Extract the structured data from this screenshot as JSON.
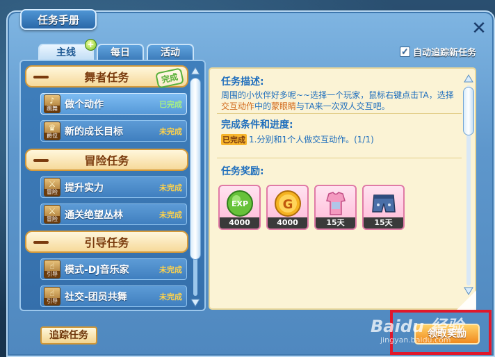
{
  "window": {
    "title": "任务手册",
    "close_icon": "close-icon"
  },
  "tabs": [
    {
      "label": "主线",
      "active": true,
      "badge": "+"
    },
    {
      "label": "每日",
      "active": false
    },
    {
      "label": "活动",
      "active": false
    }
  ],
  "auto_track": {
    "label": "自动追踪新任务",
    "checked": true,
    "check_mark": "✓"
  },
  "categories": [
    {
      "label": "舞者任务",
      "stamp": "完成",
      "tasks": [
        {
          "name": "做个动作",
          "status": "已完成",
          "icon_label": "跳舞",
          "icon_glyph": "♪",
          "done": true,
          "selected": true
        },
        {
          "name": "新的成长目标",
          "status": "未完成",
          "icon_label": "爵位",
          "icon_glyph": "♛",
          "done": false
        }
      ]
    },
    {
      "label": "冒险任务",
      "tasks": [
        {
          "name": "提升实力",
          "status": "未完成",
          "icon_label": "冒险",
          "icon_glyph": "⚔",
          "done": false
        },
        {
          "name": "通关绝望丛林",
          "status": "未完成",
          "icon_label": "冒险",
          "icon_glyph": "⚔",
          "done": false
        }
      ]
    },
    {
      "label": "引导任务",
      "tasks": [
        {
          "name": "模式-DJ音乐家",
          "status": "未完成",
          "icon_label": "引导",
          "icon_glyph": "☝",
          "done": false
        },
        {
          "name": "社交-团员共舞",
          "status": "未完成",
          "icon_label": "引导",
          "icon_glyph": "☝",
          "done": false
        }
      ]
    }
  ],
  "detail": {
    "desc_title": "任务描述:",
    "desc_parts": [
      "周围的小伙伴好多呢~~选择一个玩家，鼠标右键点击TA，选择",
      "交互动作",
      "中的",
      "蒙眼睛",
      "与TA来一次双人交互吧。"
    ],
    "progress_title": "完成条件和进度:",
    "progress_tag": "已完成",
    "progress_text": "1.分别和1个人做交互动作。(1/1)",
    "reward_title": "任务奖励:",
    "rewards": [
      {
        "type": "exp",
        "icon_text": "EXP",
        "amount": "4000"
      },
      {
        "type": "gold",
        "icon_text": "G",
        "amount": "4000"
      },
      {
        "type": "top",
        "amount": "15天"
      },
      {
        "type": "shorts",
        "amount": "15天"
      }
    ]
  },
  "buttons": {
    "track": "追踪任务",
    "claim": "领取奖励"
  },
  "watermark": {
    "text": "Baidu 经验",
    "sub": "jingyan.baidu.com"
  },
  "colors": {
    "accent_blue": "#1e6ebd",
    "highlight_orange": "#d1691b",
    "status_done": "#a6f083",
    "status_pending": "#ffd24a",
    "annotation_red": "#e0182b"
  }
}
